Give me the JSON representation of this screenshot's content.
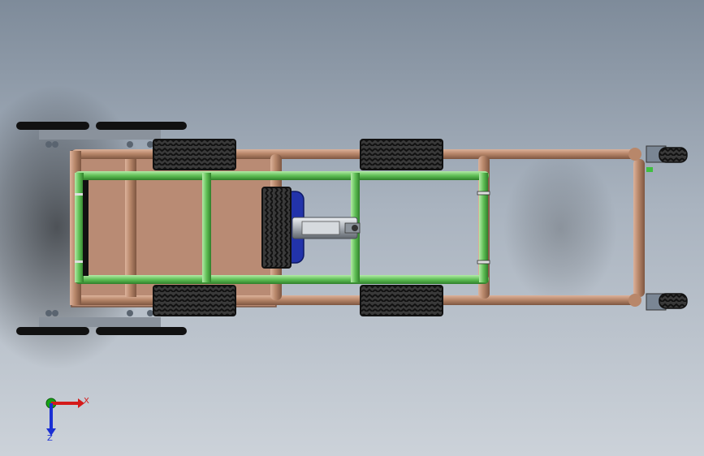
{
  "viewport": {
    "background_top": "#7f8c9b",
    "background_mid": "#b7c0ca",
    "background_bottom": "#c9d0d8"
  },
  "colors": {
    "frame_tube": "#b8876a",
    "frame_tube_shadow": "#8a5f48",
    "frame_tube_highlight": "#dcb29b",
    "inner_tube": "#5fbf55",
    "inner_tube_shadow": "#2f7f2a",
    "inner_tube_highlight": "#a8e59d",
    "floor_panel": "#b98b74",
    "tire_tread": "#3b3b3b",
    "tire_groove": "#111111",
    "seat": "#2233aa",
    "steering_shaft": "#b9bec4",
    "skid_wheel": "#111111",
    "bracket": "#6f7a88"
  },
  "triad": {
    "x_label": "X",
    "z_label": "Z",
    "x_color": "#d41a1a",
    "z_color": "#1a2fd4",
    "y_color": "#16a316"
  },
  "scene_parts": [
    "frame",
    "inner-roll-cage",
    "floor-panel",
    "rear-tires",
    "front-tires",
    "seat",
    "steering-column",
    "rear-skid-wheels",
    "front-caster-assemblies"
  ]
}
